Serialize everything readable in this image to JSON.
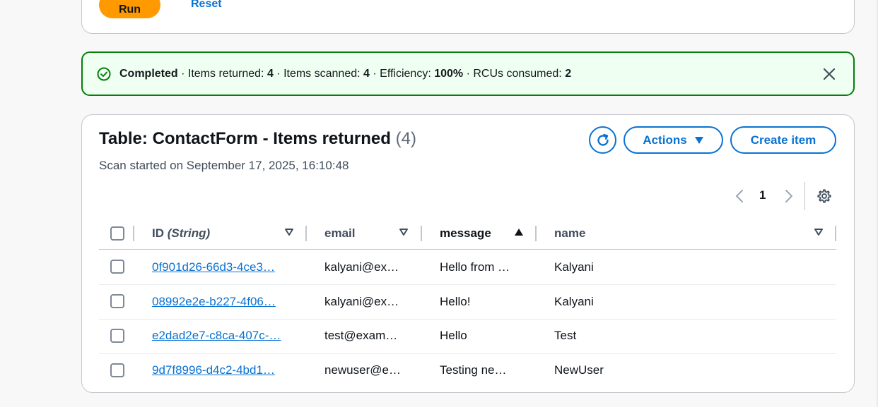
{
  "query": {
    "run_label": "Run",
    "reset_label": "Reset"
  },
  "flash": {
    "status": "Completed",
    "items_returned_label": " · Items returned: ",
    "items_returned": "4",
    "items_scanned_label": " · Items scanned: ",
    "items_scanned": "4",
    "efficiency_label": " · Efficiency: ",
    "efficiency": "100%",
    "rcus_label": " · RCUs consumed: ",
    "rcus": "2",
    "type_color": "#037f0c"
  },
  "table": {
    "title": "Table: ContactForm - Items returned",
    "count": "(4)",
    "subtitle": "Scan started on September 17, 2025, 16:10:48",
    "actions_label": "Actions",
    "create_label": "Create item",
    "page": "1",
    "columns": {
      "id": "ID",
      "id_type": "(String)",
      "email": "email",
      "message": "message",
      "name": "name"
    },
    "rows": [
      {
        "id": "0f901d26-66d3-4ce3…",
        "email": "kalyani@ex…",
        "message": "Hello from …",
        "name": "Kalyani"
      },
      {
        "id": "08992e2e-b227-4f06…",
        "email": "kalyani@ex…",
        "message": "Hello!",
        "name": "Kalyani"
      },
      {
        "id": "e2dad2e7-c8ca-407c-…",
        "email": "test@exam…",
        "message": "Hello",
        "name": "Test"
      },
      {
        "id": "9d7f8996-d4c2-4bd1…",
        "email": "newuser@e…",
        "message": "Testing ne…",
        "name": "NewUser"
      }
    ]
  },
  "colors": {
    "primary": "#0972d3",
    "run": "#ff9900",
    "success": "#037f0c"
  }
}
